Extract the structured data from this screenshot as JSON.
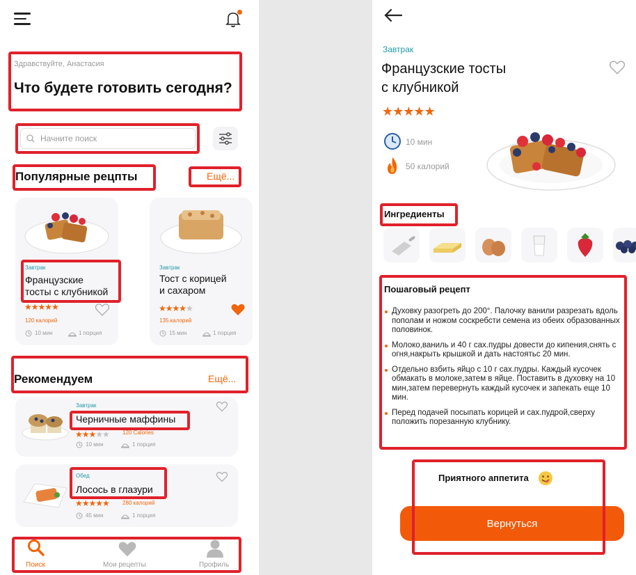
{
  "home": {
    "greeting": "Здравствуйте, Анастасия",
    "headline": "Что будете готовить сегодня?",
    "search_placeholder": "Начните поиск",
    "popular": {
      "title": "Популярные рецпты",
      "more": "Ещё...",
      "cards": [
        {
          "category": "Завтрак",
          "title_line1": "Французские",
          "title_line2": "тосты с клубникой",
          "rating": 5,
          "calories": "120 калорий",
          "time": "10 мин",
          "portion": "1 порция",
          "favorite": false
        },
        {
          "category": "Завтрак",
          "title_line1": "Тост с корицей",
          "title_line2": "и сахаром",
          "rating": 4,
          "calories": "135 калорий",
          "time": "15 мин",
          "portion": "1 порция",
          "favorite": true
        }
      ]
    },
    "recommended": {
      "title": "Рекомендуем",
      "more": "Ещё...",
      "items": [
        {
          "category": "Завтрак",
          "title": "Черничные маффины",
          "rating": 3,
          "calories": "120 Calories",
          "time": "10 мин",
          "portion": "1 порция"
        },
        {
          "category": "Обед",
          "title": "Лосось в глазури",
          "rating": 5,
          "calories": "280 калорий",
          "time": "45 мин",
          "portion": "1 порция"
        }
      ]
    },
    "nav": {
      "search": "Поиск",
      "my_recipes": "Мои рецепты",
      "profile": "Профиль"
    }
  },
  "detail": {
    "category": "Завтрак",
    "title_line1": "Французские тосты",
    "title_line2": "с клубникой",
    "rating": 5,
    "time": "10 мин",
    "calories": "50 калорий",
    "ingredients_title": "Ингредиенты",
    "ingredients": [
      "vanilla-scoop",
      "butter",
      "eggs",
      "glass-of-milk",
      "strawberry",
      "blueberries"
    ],
    "steps_title": "Пошаговый рецепт",
    "steps": [
      "Духовку разогреть до 200°. Палочку ванили разрезать вдоль пополам и ножом соскребсти семена из обеих образованных половинок.",
      "Молоко,ваниль и 40 г сах.пудры довести до кипения,снять с огня,накрыть крышкой и дать настоятьс 20 мин.",
      "Отдельно взбить яйцо с 10 г сах.пудры. Каждый кусочек обмакать в молоке,затем в яйце. Поставить в духовку на 10 мин,затем перевернуть каждый кусочек и запекать еще 10 мин.",
      "Перед подачей посыпать корицей и сах.пудрой,сверху положить порезанную клубнику."
    ],
    "enjoy": "Приятного аппетита",
    "return_button": "Вернуться"
  },
  "colors": {
    "accent": "#f2650a",
    "highlight_box": "#e0212b",
    "category": "#1f9aa8"
  }
}
